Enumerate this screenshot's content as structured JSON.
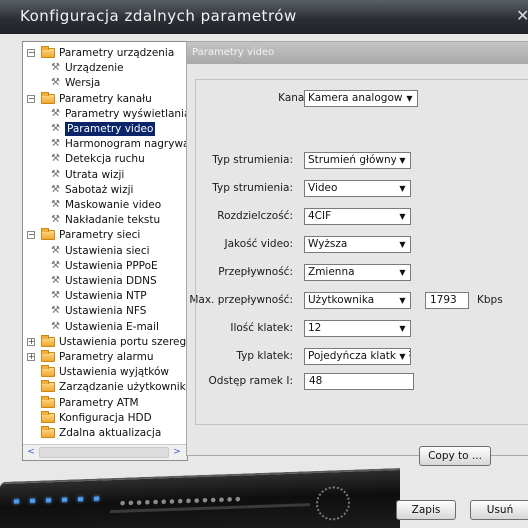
{
  "window": {
    "title": "Konfiguracja zdalnych parametrów"
  },
  "tree": {
    "items": [
      {
        "label": "Parametry urządzenia",
        "level": 0,
        "type": "folder",
        "expander": "−"
      },
      {
        "label": "Urządzenie",
        "level": 1,
        "type": "leaf"
      },
      {
        "label": "Wersja",
        "level": 1,
        "type": "leaf"
      },
      {
        "label": "Parametry kanału",
        "level": 0,
        "type": "folder",
        "expander": "−"
      },
      {
        "label": "Parametry wyświetlania",
        "level": 1,
        "type": "leaf"
      },
      {
        "label": "Parametry video",
        "level": 1,
        "type": "leaf",
        "selected": true
      },
      {
        "label": "Harmonogram nagrywania",
        "level": 1,
        "type": "leaf"
      },
      {
        "label": "Detekcja ruchu",
        "level": 1,
        "type": "leaf"
      },
      {
        "label": "Utrata wizji",
        "level": 1,
        "type": "leaf"
      },
      {
        "label": "Sabotaż wizji",
        "level": 1,
        "type": "leaf"
      },
      {
        "label": "Maskowanie video",
        "level": 1,
        "type": "leaf"
      },
      {
        "label": "Nakładanie tekstu",
        "level": 1,
        "type": "leaf"
      },
      {
        "label": "Parametry sieci",
        "level": 0,
        "type": "folder",
        "expander": "−"
      },
      {
        "label": "Ustawienia sieci",
        "level": 1,
        "type": "leaf"
      },
      {
        "label": "Ustawienia PPPoE",
        "level": 1,
        "type": "leaf"
      },
      {
        "label": "Ustawienia DDNS",
        "level": 1,
        "type": "leaf"
      },
      {
        "label": "Ustawienia NTP",
        "level": 1,
        "type": "leaf"
      },
      {
        "label": "Ustawienia NFS",
        "level": 1,
        "type": "leaf"
      },
      {
        "label": "Ustawienia E-mail",
        "level": 1,
        "type": "leaf"
      },
      {
        "label": "Ustawienia portu szeregowego",
        "level": 0,
        "type": "folder",
        "expander": "+"
      },
      {
        "label": "Parametry alarmu",
        "level": 0,
        "type": "folder",
        "expander": "+"
      },
      {
        "label": "Ustawienia wyjątków",
        "level": 0,
        "type": "folder"
      },
      {
        "label": "Zarządzanie użytkownikami",
        "level": 0,
        "type": "folder"
      },
      {
        "label": "Parametry ATM",
        "level": 0,
        "type": "folder"
      },
      {
        "label": "Konfiguracja HDD",
        "level": 0,
        "type": "folder"
      },
      {
        "label": "Zdalna aktualizacja",
        "level": 0,
        "type": "folder"
      }
    ]
  },
  "panel": {
    "header": "Parametry video",
    "kanal_label": "Kanał nr:",
    "kanal_value": "Kamera analogowa",
    "typ1_label": "Typ strumienia:",
    "typ1_value": "Strumień główny:",
    "typ2_label": "Typ strumienia:",
    "typ2_value": "Video",
    "rozdz_label": "Rozdzielczość:",
    "rozdz_value": "4CIF",
    "jakosc_label": "Jakość video:",
    "jakosc_value": "Wyższa",
    "przepl_label": "Przepływność:",
    "przepl_value": "Zmienna",
    "maxp_label": "Max. przepływność:",
    "maxp_value": "Użytkownika",
    "maxp_input": "1793",
    "maxp_unit": "Kbps",
    "ilosc_label": "Ilość klatek:",
    "ilosc_value": "12",
    "typk_label": "Typ klatek:",
    "typk_value": "Pojedyńcza klatka P",
    "odstep_label": "Odstęp ramek I:",
    "odstep_value": "48",
    "copy_label": "Copy to ..."
  },
  "buttons": {
    "save": "Zapis",
    "delete": "Usuń"
  }
}
